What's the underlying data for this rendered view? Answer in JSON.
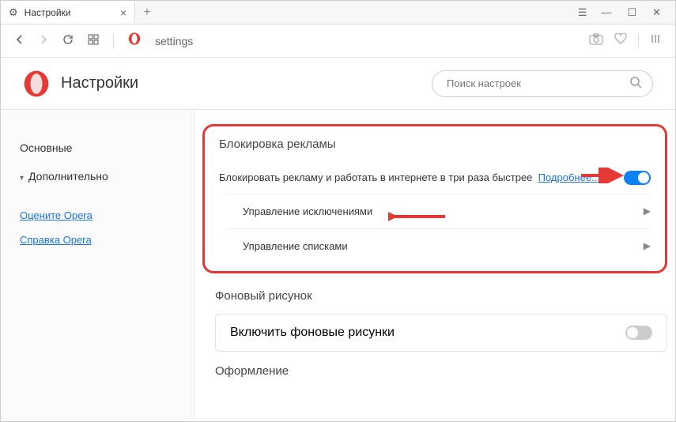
{
  "tab": {
    "title": "Настройки"
  },
  "address": {
    "text": "settings"
  },
  "header": {
    "title": "Настройки"
  },
  "search": {
    "placeholder": "Поиск настроек"
  },
  "sidebar": {
    "basic": "Основные",
    "advanced": "Дополнительно",
    "rate": "Оцените Opera",
    "help": "Справка Opera"
  },
  "adblock": {
    "title": "Блокировка рекламы",
    "desc": "Блокировать рекламу и работать в интернете в три раза быстрее",
    "learn_more": "Подробнее...",
    "manage_exceptions": "Управление исключениями",
    "manage_lists": "Управление списками"
  },
  "wallpaper": {
    "title": "Фоновый рисунок",
    "enable": "Включить фоновые рисунки"
  },
  "appearance": {
    "title": "Оформление"
  }
}
